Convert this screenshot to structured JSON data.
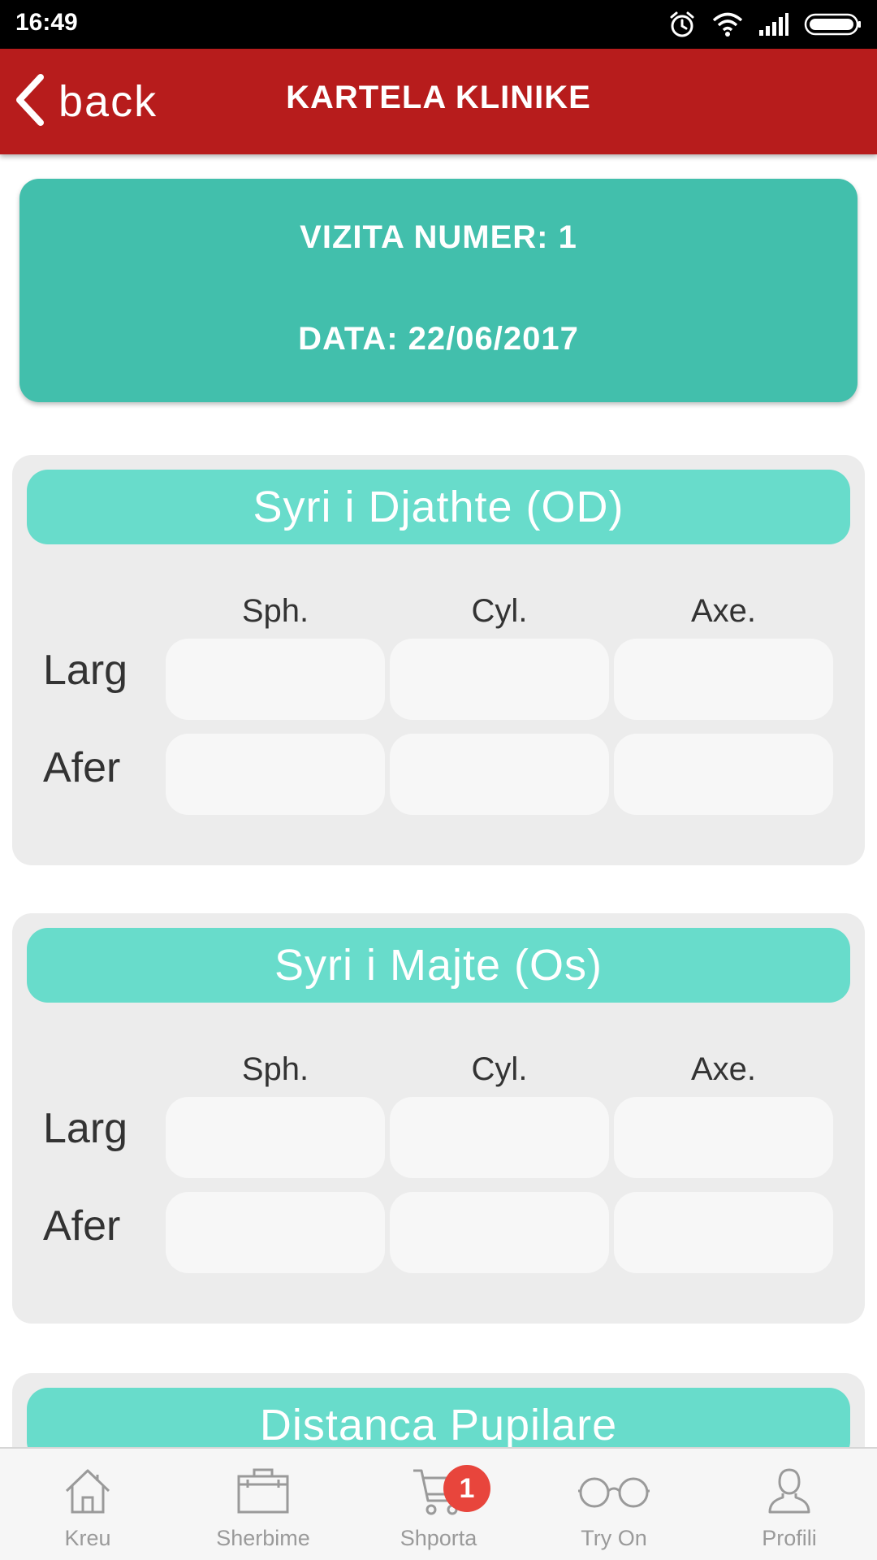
{
  "status_bar": {
    "time": "16:49",
    "icons": [
      "alarm-icon",
      "wifi-icon",
      "signal-icon",
      "battery-icon"
    ]
  },
  "app_bar": {
    "back_label": "back",
    "title": "KARTELA KLINIKE"
  },
  "visit": {
    "number_text": "VIZITA NUMER: 1",
    "date_text": "DATA: 22/06/2017"
  },
  "columns": {
    "sph": "Sph.",
    "cyl": "Cyl.",
    "axe": "Axe."
  },
  "rows": {
    "larg": "Larg",
    "afer": "Afer"
  },
  "right_eye": {
    "title": "Syri i Djathte (OD)",
    "larg": {
      "sph": "",
      "cyl": "",
      "axe": ""
    },
    "afer": {
      "sph": "",
      "cyl": "",
      "axe": ""
    }
  },
  "left_eye": {
    "title": "Syri i Majte (Os)",
    "larg": {
      "sph": "",
      "cyl": "",
      "axe": ""
    },
    "afer": {
      "sph": "",
      "cyl": "",
      "axe": ""
    }
  },
  "pupillary": {
    "title": "Distanca Pupilare"
  },
  "bottom_nav": {
    "items": [
      {
        "label": "Kreu",
        "icon": "home-icon"
      },
      {
        "label": "Sherbime",
        "icon": "briefcase-icon"
      },
      {
        "label": "Shporta",
        "icon": "cart-icon"
      },
      {
        "label": "Try On",
        "icon": "glasses-icon"
      },
      {
        "label": "Profili",
        "icon": "profile-icon"
      }
    ],
    "cart_badge": "1"
  },
  "colors": {
    "app_bar": "#b71c1c",
    "visit_card": "#42bfac",
    "panel_header": "#68dccb",
    "panel_bg": "#ececec",
    "cell_bg": "#f7f7f7",
    "badge": "#e8453c"
  }
}
